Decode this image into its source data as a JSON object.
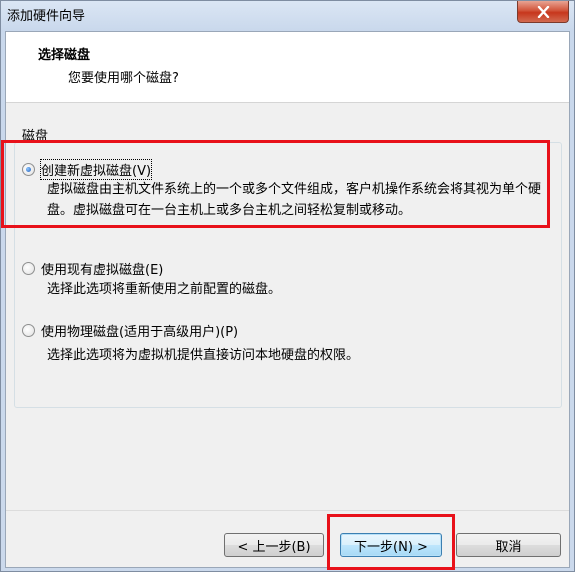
{
  "window": {
    "title": "添加硬件向导",
    "close_icon": "close-icon"
  },
  "header": {
    "title": "选择磁盘",
    "subtitle": "您要使用哪个磁盘?"
  },
  "group": {
    "label": "磁盘"
  },
  "options": [
    {
      "label": "创建新虚拟磁盘(V)",
      "description": "虚拟磁盘由主机文件系统上的一个或多个文件组成，客户机操作系统会将其视为单个硬盘。虚拟磁盘可在一台主机上或多台主机之间轻松复制或移动。",
      "selected": true
    },
    {
      "label": "使用现有虚拟磁盘(E)",
      "description": "选择此选项将重新使用之前配置的磁盘。",
      "selected": false
    },
    {
      "label": "使用物理磁盘(适用于高级用户)(P)",
      "description": "选择此选项将为虚拟机提供直接访问本地硬盘的权限。",
      "selected": false
    }
  ],
  "buttons": {
    "back": "< 上一步(B)",
    "next": "下一步(N) >",
    "cancel": "取消"
  },
  "colors": {
    "highlight": "#e8111a"
  }
}
